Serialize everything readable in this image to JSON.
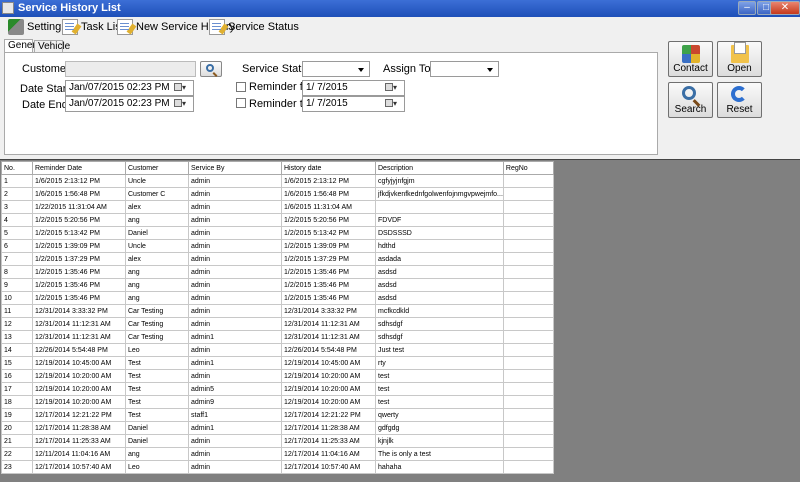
{
  "window": {
    "title": "Service History List"
  },
  "toolbar": {
    "setting": "Setting",
    "task_list": "Task List",
    "new_service_history": "New Service History",
    "service_status": "Service Status"
  },
  "tabs": {
    "general": "General",
    "vehicle": "Vehicle"
  },
  "filters": {
    "customer_label": "Customer",
    "customer_value": "",
    "date_start_label": "Date Start",
    "date_start_value": "Jan/07/2015 02:23 PM",
    "date_end_label": "Date End",
    "date_end_value": "Jan/07/2015 02:23 PM",
    "service_status_label": "Service Status",
    "service_status_value": "",
    "assign_to_label": "Assign To",
    "assign_to_value": "",
    "reminder_from_label": "Reminder fr.",
    "reminder_from_value": "1/  7/2015",
    "reminder_to_label": "Reminder to",
    "reminder_to_value": "1/  7/2015"
  },
  "actions": {
    "contact": "Contact",
    "open": "Open",
    "search": "Search",
    "reset": "Reset"
  },
  "table": {
    "columns": [
      "No.",
      "Reminder Date",
      "Customer",
      "Service By",
      "History date",
      "Description",
      "RegNo"
    ],
    "rows": [
      [
        "1",
        "1/6/2015 2:13:12 PM",
        "Uncle",
        "admin",
        "1/6/2015 2:13:12 PM",
        "cgfyjyjnfgjm",
        ""
      ],
      [
        "2",
        "1/6/2015 1:56:48 PM",
        "Customer C",
        "admin",
        "1/6/2015 1:56:48 PM",
        "jfkdjvkenfkednfgolwenfojnmgvpwejmfo...",
        ""
      ],
      [
        "3",
        "1/22/2015 11:31:04 AM",
        "alex",
        "admin",
        "1/6/2015 11:31:04 AM",
        "",
        ""
      ],
      [
        "4",
        "1/2/2015 5:20:56 PM",
        "ang",
        "admin",
        "1/2/2015 5:20:56 PM",
        "FDVDF",
        ""
      ],
      [
        "5",
        "1/2/2015 5:13:42 PM",
        "Daniel",
        "admin",
        "1/2/2015 5:13:42 PM",
        "DSDSSSD",
        ""
      ],
      [
        "6",
        "1/2/2015 1:39:09 PM",
        "Uncle",
        "admin",
        "1/2/2015 1:39:09 PM",
        "hdthd",
        ""
      ],
      [
        "7",
        "1/2/2015 1:37:29 PM",
        "alex",
        "admin",
        "1/2/2015 1:37:29 PM",
        "asdada",
        ""
      ],
      [
        "8",
        "1/2/2015 1:35:46 PM",
        "ang",
        "admin",
        "1/2/2015 1:35:46 PM",
        "asdsd",
        ""
      ],
      [
        "9",
        "1/2/2015 1:35:46 PM",
        "ang",
        "admin",
        "1/2/2015 1:35:46 PM",
        "asdsd",
        ""
      ],
      [
        "10",
        "1/2/2015 1:35:46 PM",
        "ang",
        "admin",
        "1/2/2015 1:35:46 PM",
        "asdsd",
        ""
      ],
      [
        "11",
        "12/31/2014 3:33:32 PM",
        "Car Testing",
        "admin",
        "12/31/2014 3:33:32 PM",
        "mcfkcdkld",
        ""
      ],
      [
        "12",
        "12/31/2014 11:12:31 AM",
        "Car Testing",
        "admin",
        "12/31/2014 11:12:31 AM",
        "sdhsdgf",
        ""
      ],
      [
        "13",
        "12/31/2014 11:12:31 AM",
        "Car Testing",
        "admin1",
        "12/31/2014 11:12:31 AM",
        "sdhsdgf",
        ""
      ],
      [
        "14",
        "12/26/2014 5:54:48 PM",
        "Leo",
        "admin",
        "12/26/2014 5:54:48 PM",
        "Just test",
        ""
      ],
      [
        "15",
        "12/19/2014 10:45:00 AM",
        "Test",
        "admin1",
        "12/19/2014 10:45:00 AM",
        "rty",
        ""
      ],
      [
        "16",
        "12/19/2014 10:20:00 AM",
        "Test",
        "admin",
        "12/19/2014 10:20:00 AM",
        "test",
        ""
      ],
      [
        "17",
        "12/19/2014 10:20:00 AM",
        "Test",
        "admin5",
        "12/19/2014 10:20:00 AM",
        "test",
        ""
      ],
      [
        "18",
        "12/19/2014 10:20:00 AM",
        "Test",
        "admin9",
        "12/19/2014 10:20:00 AM",
        "test",
        ""
      ],
      [
        "19",
        "12/17/2014 12:21:22 PM",
        "Test",
        "staff1",
        "12/17/2014 12:21:22 PM",
        "qwerty",
        ""
      ],
      [
        "20",
        "12/17/2014 11:28:38 AM",
        "Daniel",
        "admin1",
        "12/17/2014 11:28:38 AM",
        "gdfgdg",
        ""
      ],
      [
        "21",
        "12/17/2014 11:25:33 AM",
        "Daniel",
        "admin",
        "12/17/2014 11:25:33 AM",
        "kjnjlk",
        ""
      ],
      [
        "22",
        "12/11/2014 11:04:16 AM",
        "ang",
        "admin",
        "12/17/2014 11:04:16 AM",
        "The is only a test",
        ""
      ],
      [
        "23",
        "12/17/2014 10:57:40 AM",
        "Leo",
        "admin",
        "12/17/2014 10:57:40 AM",
        "hahaha",
        ""
      ]
    ]
  }
}
